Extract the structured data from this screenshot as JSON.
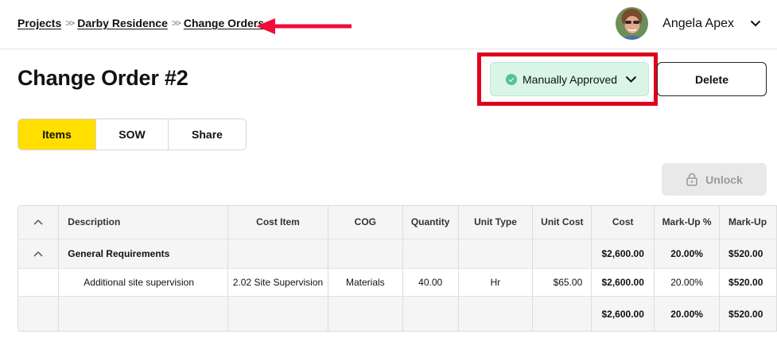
{
  "breadcrumb": {
    "items": [
      {
        "label": "Projects"
      },
      {
        "label": "Darby Residence"
      },
      {
        "label": "Change Orders"
      }
    ],
    "separator": ">>"
  },
  "user": {
    "name": "Angela Apex"
  },
  "page": {
    "title": "Change Order #2"
  },
  "status": {
    "label": "Manually Approved",
    "color": "#d8f5e7",
    "dot_color": "#54c28c"
  },
  "actions": {
    "delete_label": "Delete",
    "unlock_label": "Unlock"
  },
  "tabs": [
    {
      "label": "Items",
      "active": true
    },
    {
      "label": "SOW",
      "active": false
    },
    {
      "label": "Share",
      "active": false
    }
  ],
  "table": {
    "headers": {
      "description": "Description",
      "cost_item": "Cost Item",
      "cog": "COG",
      "quantity": "Quantity",
      "unit_type": "Unit Type",
      "unit_cost": "Unit Cost",
      "cost": "Cost",
      "markup_pct": "Mark-Up %",
      "markup": "Mark-Up"
    },
    "group": {
      "name": "General Requirements",
      "cost": "$2,600.00",
      "markup_pct": "20.00%",
      "markup": "$520.00"
    },
    "rows": [
      {
        "description": "Additional site supervision",
        "cost_item": "2.02 Site Supervision",
        "cog": "Materials",
        "quantity": "40.00",
        "unit_type": "Hr",
        "unit_cost": "$65.00",
        "cost": "$2,600.00",
        "markup_pct": "20.00%",
        "markup": "$520.00"
      }
    ],
    "totals": {
      "cost": "$2,600.00",
      "markup_pct": "20.00%",
      "markup": "$520.00"
    }
  },
  "colors": {
    "accent": "#ffde00",
    "annotation": "#e0001b"
  }
}
